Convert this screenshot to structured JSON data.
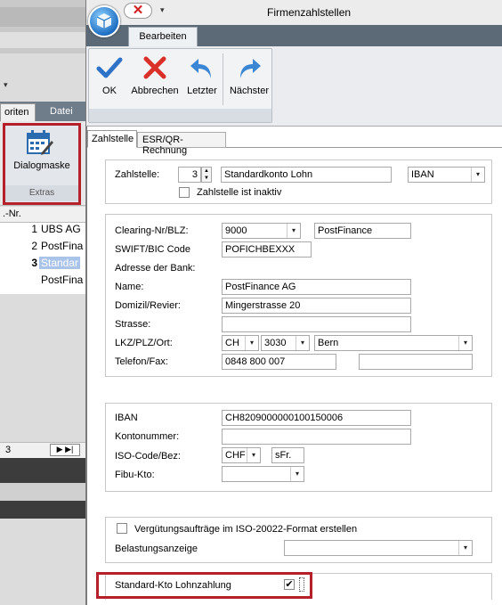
{
  "window": {
    "title": "Firmenzahlstellen",
    "qat_close": "✕",
    "qat_more": "▾"
  },
  "ribbon": {
    "tab": "Bearbeiten",
    "buttons": {
      "ok": "OK",
      "abbrechen": "Abbrechen",
      "letzter": "Letzter",
      "naechster": "Nächster"
    }
  },
  "background_app": {
    "tabs": {
      "favoriten": "oriten",
      "datei": "Datei"
    },
    "dialogmaske": "Dialogmaske",
    "extras": "Extras",
    "grid_header": ".-Nr.",
    "rows": [
      {
        "num": "1",
        "name": "UBS AG"
      },
      {
        "num": "2",
        "name": "PostFina"
      },
      {
        "num": "3",
        "name": "Standar"
      },
      {
        "num": "",
        "name": "PostFina"
      }
    ],
    "nav_value": "3",
    "nav_buttons": "▶ ▶|",
    "dropdown_arrow": "▾"
  },
  "content_tabs": {
    "zahlstelle": "Zahlstelle",
    "esr": "ESR/QR-Rechnung"
  },
  "zahlstelle": {
    "label": "Zahlstelle:",
    "number": "3",
    "name": "Standardkonto Lohn",
    "type": "IBAN",
    "inactive_label": "Zahlstelle ist inaktiv",
    "inactive_checked": false
  },
  "bank": {
    "clearing_label": "Clearing-Nr/BLZ:",
    "clearing_value": "9000",
    "clearing_name": "PostFinance",
    "swift_label": "SWIFT/BIC Code",
    "swift_value": "POFICHBEXXX",
    "adresse_label": "Adresse der Bank:",
    "name_label": "Name:",
    "name_value": "PostFinance AG",
    "domizil_label": "Domizil/Revier:",
    "domizil_value": "Mingerstrasse 20",
    "strasse_label": "Strasse:",
    "strasse_value": "",
    "ort_label": "LKZ/PLZ/Ort:",
    "lkz_value": "CH",
    "plz_value": "3030",
    "ort_value": "Bern",
    "telefon_label": "Telefon/Fax:",
    "telefon_value": "0848 800 007",
    "fax_value": ""
  },
  "konto": {
    "iban_label": "IBAN",
    "iban_value": "CH8209000000100150006",
    "kontonummer_label": "Kontonummer:",
    "kontonummer_value": "",
    "iso_label": "ISO-Code/Bez:",
    "iso_value": "CHF",
    "iso_bez": "sFr.",
    "fibu_label": "Fibu-Kto:",
    "fibu_value": ""
  },
  "options": {
    "iso20022_label": "Vergütungsaufträge im ISO-20022-Format erstellen",
    "iso20022_checked": false,
    "belastung_label": "Belastungsanzeige",
    "belastung_value": ""
  },
  "standard": {
    "label": "Standard-Kto Lohnzahlung",
    "checked": true
  },
  "icons": {
    "dropdown": "▾",
    "spin_up": "▲",
    "spin_down": "▼",
    "check": "✔"
  }
}
